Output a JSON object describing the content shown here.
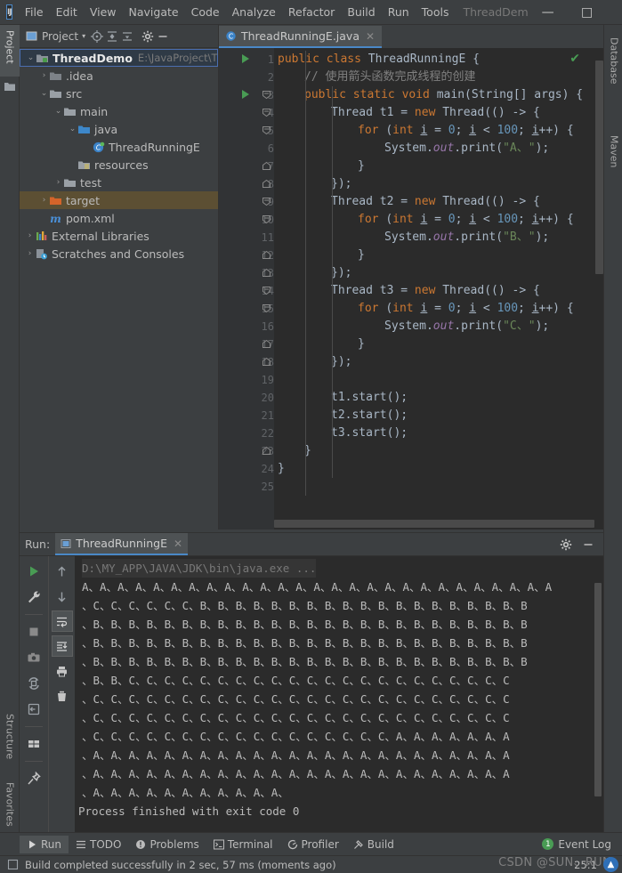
{
  "window": {
    "title": "ThreadDem",
    "logo": "IJ",
    "minimize": "—",
    "maximize": "□",
    "close": "✕"
  },
  "menu": {
    "items": [
      "File",
      "Edit",
      "View",
      "Navigate",
      "Code",
      "Analyze",
      "Refactor",
      "Build",
      "Run",
      "Tools"
    ]
  },
  "left_strip": {
    "project_tab": "Project",
    "structure_tab": "Structure",
    "favorites_tab": "Favorites"
  },
  "right_strip": {
    "database_tab": "Database",
    "maven_tab": "Maven"
  },
  "project_panel": {
    "header_label": "Project",
    "toolbar_icons": [
      "locate-icon",
      "collapse-all-icon",
      "expand-icon",
      "gear-icon",
      "hide-icon"
    ],
    "tree": [
      {
        "indent": 0,
        "arrow": "⌄",
        "icon": "module-icon",
        "label": "ThreadDemo",
        "path": "E:\\JavaProject\\T",
        "bold": true,
        "state": "selected-blue"
      },
      {
        "indent": 1,
        "arrow": "›",
        "icon": "folder-excluded-icon",
        "label": ".idea",
        "path": "",
        "bold": false,
        "state": "none"
      },
      {
        "indent": 1,
        "arrow": "⌄",
        "icon": "folder-icon",
        "label": "src",
        "path": "",
        "bold": false,
        "state": "none"
      },
      {
        "indent": 2,
        "arrow": "⌄",
        "icon": "folder-icon",
        "label": "main",
        "path": "",
        "bold": false,
        "state": "none"
      },
      {
        "indent": 3,
        "arrow": "⌄",
        "icon": "source-folder-icon",
        "label": "java",
        "path": "",
        "bold": false,
        "state": "none"
      },
      {
        "indent": 4,
        "arrow": "",
        "icon": "java-class-icon",
        "label": "ThreadRunningE",
        "path": "",
        "bold": false,
        "state": "none"
      },
      {
        "indent": 3,
        "arrow": "",
        "icon": "resources-folder-icon",
        "label": "resources",
        "path": "",
        "bold": false,
        "state": "none"
      },
      {
        "indent": 2,
        "arrow": "›",
        "icon": "folder-icon",
        "label": "test",
        "path": "",
        "bold": false,
        "state": "none"
      },
      {
        "indent": 1,
        "arrow": "›",
        "icon": "target-folder-icon",
        "label": "target",
        "path": "",
        "bold": false,
        "state": "selected-brown"
      },
      {
        "indent": 1,
        "arrow": "",
        "icon": "maven-pom-icon",
        "label": "pom.xml",
        "path": "",
        "bold": false,
        "state": "none"
      },
      {
        "indent": 0,
        "arrow": "›",
        "icon": "libraries-icon",
        "label": "External Libraries",
        "path": "",
        "bold": false,
        "state": "none"
      },
      {
        "indent": 0,
        "arrow": "›",
        "icon": "scratches-icon",
        "label": "Scratches and Consoles",
        "path": "",
        "bold": false,
        "state": "none"
      }
    ]
  },
  "editor": {
    "tab_label": "ThreadRunningE.java",
    "tab_close": "✕",
    "inspection_mark": "✔",
    "lines": [
      {
        "n": "1",
        "run": true,
        "fold": "",
        "indent": 0,
        "tokens": [
          {
            "t": "public ",
            "c": "kw"
          },
          {
            "t": "class ",
            "c": "kw"
          },
          {
            "t": "ThreadRunningE ",
            "c": "cls"
          },
          {
            "t": "{",
            "c": "pln"
          }
        ]
      },
      {
        "n": "2",
        "run": false,
        "fold": "",
        "indent": 1,
        "tokens": [
          {
            "t": "// 使用箭头函数完成线程的创建",
            "c": "cmt"
          }
        ]
      },
      {
        "n": "3",
        "run": true,
        "fold": "start",
        "indent": 1,
        "tokens": [
          {
            "t": "public static void ",
            "c": "kw"
          },
          {
            "t": "main",
            "c": "cls"
          },
          {
            "t": "(String[] args) {",
            "c": "pln"
          }
        ]
      },
      {
        "n": "4",
        "run": false,
        "fold": "start",
        "indent": 2,
        "tokens": [
          {
            "t": "Thread t1 = ",
            "c": "pln"
          },
          {
            "t": "new ",
            "c": "kw"
          },
          {
            "t": "Thread(() -> {",
            "c": "pln"
          }
        ]
      },
      {
        "n": "5",
        "run": false,
        "fold": "start",
        "indent": 3,
        "tokens": [
          {
            "t": "for ",
            "c": "kw"
          },
          {
            "t": "(",
            "c": "pln"
          },
          {
            "t": "int ",
            "c": "kw"
          },
          {
            "t": "i",
            "c": "var"
          },
          {
            "t": " = ",
            "c": "pln"
          },
          {
            "t": "0",
            "c": "num"
          },
          {
            "t": "; ",
            "c": "pln"
          },
          {
            "t": "i",
            "c": "var"
          },
          {
            "t": " < ",
            "c": "pln"
          },
          {
            "t": "100",
            "c": "num"
          },
          {
            "t": "; ",
            "c": "pln"
          },
          {
            "t": "i",
            "c": "var"
          },
          {
            "t": "++) {",
            "c": "pln"
          }
        ]
      },
      {
        "n": "6",
        "run": false,
        "fold": "",
        "indent": 4,
        "tokens": [
          {
            "t": "System.",
            "c": "pln"
          },
          {
            "t": "out",
            "c": "fld"
          },
          {
            "t": ".print(",
            "c": "pln"
          },
          {
            "t": "\"A、\"",
            "c": "str"
          },
          {
            "t": ");",
            "c": "pln"
          }
        ]
      },
      {
        "n": "7",
        "run": false,
        "fold": "end",
        "indent": 3,
        "tokens": [
          {
            "t": "}",
            "c": "pln"
          }
        ]
      },
      {
        "n": "8",
        "run": false,
        "fold": "end",
        "indent": 2,
        "tokens": [
          {
            "t": "});",
            "c": "pln"
          }
        ]
      },
      {
        "n": "9",
        "run": false,
        "fold": "start",
        "indent": 2,
        "tokens": [
          {
            "t": "Thread t2 = ",
            "c": "pln"
          },
          {
            "t": "new ",
            "c": "kw"
          },
          {
            "t": "Thread(() -> {",
            "c": "pln"
          }
        ]
      },
      {
        "n": "10",
        "run": false,
        "fold": "start",
        "indent": 3,
        "tokens": [
          {
            "t": "for ",
            "c": "kw"
          },
          {
            "t": "(",
            "c": "pln"
          },
          {
            "t": "int ",
            "c": "kw"
          },
          {
            "t": "i",
            "c": "var"
          },
          {
            "t": " = ",
            "c": "pln"
          },
          {
            "t": "0",
            "c": "num"
          },
          {
            "t": "; ",
            "c": "pln"
          },
          {
            "t": "i",
            "c": "var"
          },
          {
            "t": " < ",
            "c": "pln"
          },
          {
            "t": "100",
            "c": "num"
          },
          {
            "t": "; ",
            "c": "pln"
          },
          {
            "t": "i",
            "c": "var"
          },
          {
            "t": "++) {",
            "c": "pln"
          }
        ]
      },
      {
        "n": "11",
        "run": false,
        "fold": "",
        "indent": 4,
        "tokens": [
          {
            "t": "System.",
            "c": "pln"
          },
          {
            "t": "out",
            "c": "fld"
          },
          {
            "t": ".print(",
            "c": "pln"
          },
          {
            "t": "\"B、\"",
            "c": "str"
          },
          {
            "t": ");",
            "c": "pln"
          }
        ]
      },
      {
        "n": "12",
        "run": false,
        "fold": "end",
        "indent": 3,
        "tokens": [
          {
            "t": "}",
            "c": "pln"
          }
        ]
      },
      {
        "n": "13",
        "run": false,
        "fold": "end",
        "indent": 2,
        "tokens": [
          {
            "t": "});",
            "c": "pln"
          }
        ]
      },
      {
        "n": "14",
        "run": false,
        "fold": "start",
        "indent": 2,
        "tokens": [
          {
            "t": "Thread t3 = ",
            "c": "pln"
          },
          {
            "t": "new ",
            "c": "kw"
          },
          {
            "t": "Thread(() -> {",
            "c": "pln"
          }
        ]
      },
      {
        "n": "15",
        "run": false,
        "fold": "start",
        "indent": 3,
        "tokens": [
          {
            "t": "for ",
            "c": "kw"
          },
          {
            "t": "(",
            "c": "pln"
          },
          {
            "t": "int ",
            "c": "kw"
          },
          {
            "t": "i",
            "c": "var"
          },
          {
            "t": " = ",
            "c": "pln"
          },
          {
            "t": "0",
            "c": "num"
          },
          {
            "t": "; ",
            "c": "pln"
          },
          {
            "t": "i",
            "c": "var"
          },
          {
            "t": " < ",
            "c": "pln"
          },
          {
            "t": "100",
            "c": "num"
          },
          {
            "t": "; ",
            "c": "pln"
          },
          {
            "t": "i",
            "c": "var"
          },
          {
            "t": "++) {",
            "c": "pln"
          }
        ]
      },
      {
        "n": "16",
        "run": false,
        "fold": "",
        "indent": 4,
        "tokens": [
          {
            "t": "System.",
            "c": "pln"
          },
          {
            "t": "out",
            "c": "fld"
          },
          {
            "t": ".print(",
            "c": "pln"
          },
          {
            "t": "\"C、\"",
            "c": "str"
          },
          {
            "t": ");",
            "c": "pln"
          }
        ]
      },
      {
        "n": "17",
        "run": false,
        "fold": "end",
        "indent": 3,
        "tokens": [
          {
            "t": "}",
            "c": "pln"
          }
        ]
      },
      {
        "n": "18",
        "run": false,
        "fold": "end",
        "indent": 2,
        "tokens": [
          {
            "t": "});",
            "c": "pln"
          }
        ]
      },
      {
        "n": "19",
        "run": false,
        "fold": "",
        "indent": 0,
        "tokens": []
      },
      {
        "n": "20",
        "run": false,
        "fold": "",
        "indent": 2,
        "tokens": [
          {
            "t": "t1.start",
            "c": "pln"
          },
          {
            "t": "();",
            "c": "pln"
          }
        ]
      },
      {
        "n": "21",
        "run": false,
        "fold": "",
        "indent": 2,
        "tokens": [
          {
            "t": "t2.start",
            "c": "pln"
          },
          {
            "t": "();",
            "c": "pln"
          }
        ]
      },
      {
        "n": "22",
        "run": false,
        "fold": "",
        "indent": 2,
        "tokens": [
          {
            "t": "t3.start",
            "c": "pln"
          },
          {
            "t": "();",
            "c": "pln"
          }
        ]
      },
      {
        "n": "23",
        "run": false,
        "fold": "end",
        "indent": 1,
        "tokens": [
          {
            "t": "}",
            "c": "pln"
          }
        ]
      },
      {
        "n": "24",
        "run": false,
        "fold": "",
        "indent": 0,
        "tokens": [
          {
            "t": "}",
            "c": "pln"
          }
        ]
      },
      {
        "n": "25",
        "run": false,
        "fold": "",
        "indent": 0,
        "tokens": []
      }
    ]
  },
  "run_panel": {
    "label": "Run:",
    "tab_label": "ThreadRunningE",
    "tab_close": "✕",
    "settings_icon": "gear-icon",
    "hide_icon": "hide-icon",
    "toolbar_left": [
      "rerun-icon",
      "wrench-icon",
      "stop-icon",
      "camera-icon",
      "restore-layout-icon",
      "export-icon",
      "layout-icon",
      "pin-icon"
    ],
    "toolbar_right": [
      "up-arrow-icon",
      "down-arrow-icon",
      "soft-wrap-icon",
      "scroll-to-end-icon",
      "print-icon",
      "trash-icon"
    ],
    "console": {
      "command": "D:\\MY_APP\\JAVA\\JDK\\bin\\java.exe ...",
      "lines": [
        "A、A、A、A、A、A、A、A、A、A、A、A、A、A、A、A、A、A、A、A、A、A、A、A、A、A、A",
        "、C、C、C、C、C、C、B、B、B、B、B、B、B、B、B、B、B、B、B、B、B、B、B、B、B",
        "、B、B、B、B、B、B、B、B、B、B、B、B、B、B、B、B、B、B、B、B、B、B、B、B、B",
        "、B、B、B、B、B、B、B、B、B、B、B、B、B、B、B、B、B、B、B、B、B、B、B、B、B",
        "、B、B、B、B、B、B、B、B、B、B、B、B、B、B、B、B、B、B、B、B、B、B、B、B、B",
        "、B、B、C、C、C、C、C、C、C、C、C、C、C、C、C、C、C、C、C、C、C、C、C、C",
        "、C、C、C、C、C、C、C、C、C、C、C、C、C、C、C、C、C、C、C、C、C、C、C、C",
        "、C、C、C、C、C、C、C、C、C、C、C、C、C、C、C、C、C、C、C、C、C、C、C、C",
        "、C、C、C、C、C、C、C、C、C、C、C、C、C、C、C、C、C、A、A、A、A、A、A、A",
        "、A、A、A、A、A、A、A、A、A、A、A、A、A、A、A、A、A、A、A、A、A、A、A、A",
        "、A、A、A、A、A、A、A、A、A、A、A、A、A、A、A、A、A、A、A、A、A、A、A、A",
        "、A、A、A、A、A、A、A、A、A、A、A、"
      ],
      "finish_message": "Process finished with exit code 0"
    }
  },
  "toolwindow_bar": {
    "items": [
      {
        "icon": "run-icon",
        "label": "Run",
        "selected": true
      },
      {
        "icon": "todo-icon",
        "label": "TODO",
        "selected": false
      },
      {
        "icon": "problems-icon",
        "label": "Problems",
        "selected": false
      },
      {
        "icon": "terminal-icon",
        "label": "Terminal",
        "selected": false
      },
      {
        "icon": "profiler-icon",
        "label": "Profiler",
        "selected": false
      },
      {
        "icon": "build-icon",
        "label": "Build",
        "selected": false
      }
    ],
    "event_log": {
      "label": "Event Log",
      "badge": "1"
    }
  },
  "statusbar": {
    "message": "Build completed successfully in 2 sec, 57 ms (moments ago)",
    "caret_position": "25:1",
    "watermark": "CSDN @SUN、RUN"
  },
  "colors": {
    "accent_blue": "#4a88c7",
    "keyword_orange": "#cc7832",
    "string_green": "#6a8759",
    "number_blue": "#6897bb",
    "field_purple": "#9876aa",
    "comment_gray": "#808080",
    "run_green": "#499C54",
    "panel_bg": "#3c3f41",
    "editor_bg": "#2b2b2b",
    "selection_brown": "#5c4f33"
  }
}
